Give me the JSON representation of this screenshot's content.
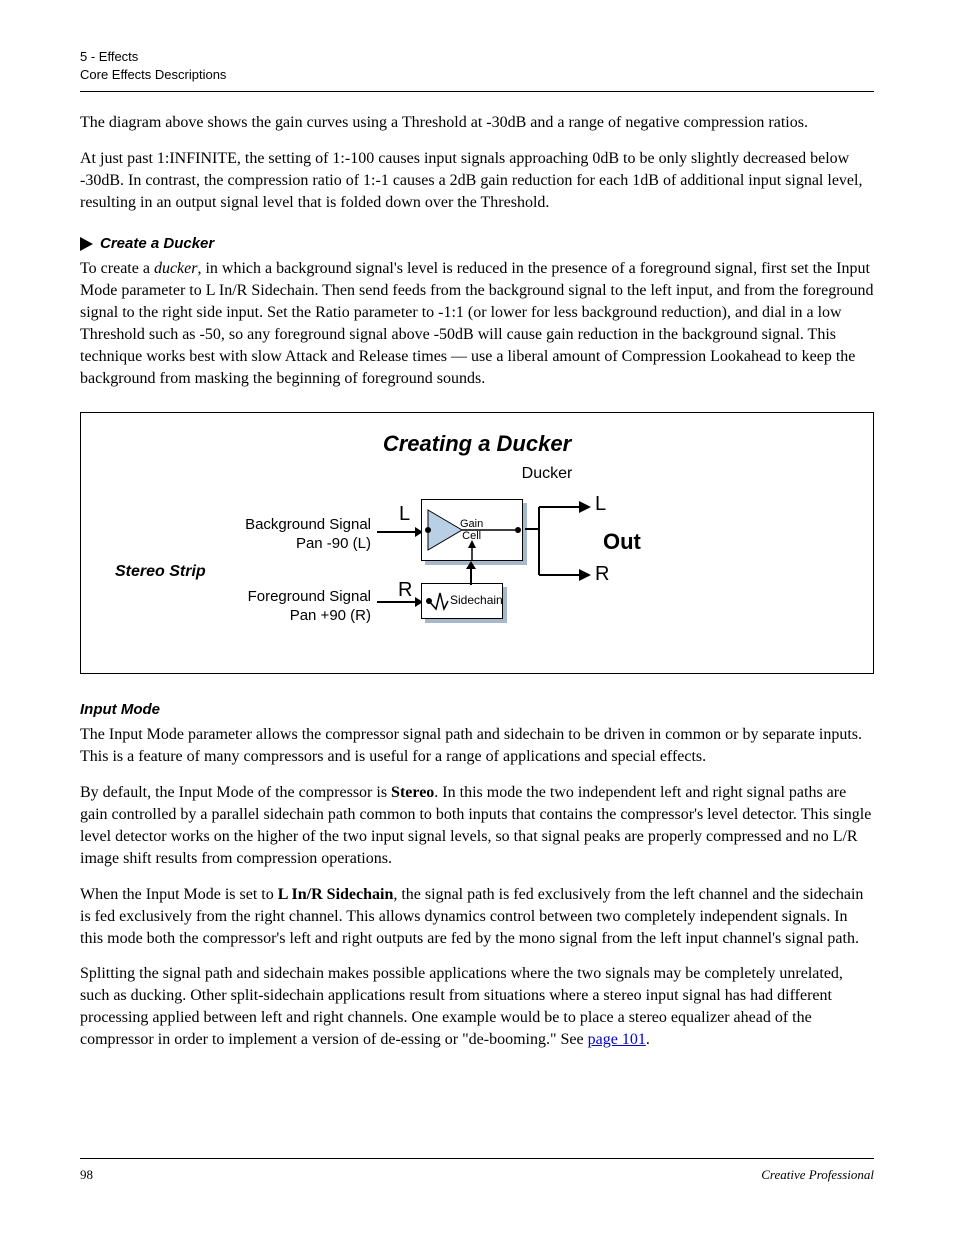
{
  "header": {
    "chapter": "5 - Effects",
    "section": "Core Effects Descriptions"
  },
  "paragraphs": {
    "p1": "The diagram above shows the gain curves using a Threshold at -30dB and a range of negative compression ratios.",
    "p2": "At just past 1:INFINITE,  the setting of 1:-100 causes input signals approaching 0dB to be only slightly decreased below -30dB. In contrast, the compression ratio of 1:-1 causes a 2dB gain reduction for each 1dB of additional input signal level, resulting in an output signal level that is folded down over the Threshold."
  },
  "ducker": {
    "heading": "Create a Ducker",
    "para_pre": "To create a ",
    "para_em": "ducker",
    "para_post": ", in which a background signal's level is reduced in the presence of a foreground signal, first set the Input Mode parameter to L In/R Sidechain. Then send feeds from the background signal to the left input, and from the foreground signal to the right side input. Set the Ratio parameter to -1:1 (or lower for less background reduction), and dial in a low Threshold such as -50, so any foreground signal above -50dB will cause gain reduction in the background signal. This technique works best with slow Attack and Release times — use a liberal amount of Compression Lookahead to keep the background from masking the beginning of foreground sounds."
  },
  "figure": {
    "title": "Creating a Ducker",
    "ducker_label": "Ducker",
    "bg_line1": "Background Signal",
    "bg_line2": "Pan -90 (L)",
    "fg_line1": "Foreground Signal",
    "fg_line2": "Pan +90 (R)",
    "stereo_strip": "Stereo Strip",
    "in_L": "L",
    "in_R": "R",
    "out_L": "L",
    "out_R": "R",
    "out_label": "Out",
    "gain_cell_1": "Gain",
    "gain_cell_2": "Cell",
    "sidechain": "Sidechain"
  },
  "inputmode": {
    "heading": "Input Mode",
    "p1": "The Input Mode parameter allows the compressor signal path and sidechain to be driven in common or by separate inputs. This is a feature of many compressors and is useful for a range of applications and special effects.",
    "p2_pre": "By default, the Input Mode of the compressor is ",
    "p2_bold": "Stereo",
    "p2_post": ". In this mode the two independent left and right signal paths are gain controlled by a parallel sidechain path common to both inputs that contains the compressor's level detector. This single level detector works on the higher of the two input signal levels, so that signal peaks are properly compressed and no L/R image shift results from compression operations.",
    "p3_pre": "When the Input Mode is set to ",
    "p3_bold": "L In/R Sidechain",
    "p3_post": ", the signal path is fed exclusively from the left channel and the sidechain is fed exclusively from the right channel. This allows dynamics control between two completely independent signals. In this mode both the compressor's left and right outputs are fed by the mono signal from the left input channel's signal path.",
    "p4_pre": "Splitting the signal path and sidechain makes possible applications where the two signals may be completely unrelated, such as ducking. Other split-sidechain applications result from situations where a stereo input signal has had different processing applied between left and right channels. One example would be to place a stereo equalizer ahead of the compressor in order to implement a version of de-essing or \"de-booming.\" See ",
    "p4_link": "page 101",
    "p4_post": "."
  },
  "footer": {
    "page_number": "98",
    "publisher": "Creative Professional"
  }
}
